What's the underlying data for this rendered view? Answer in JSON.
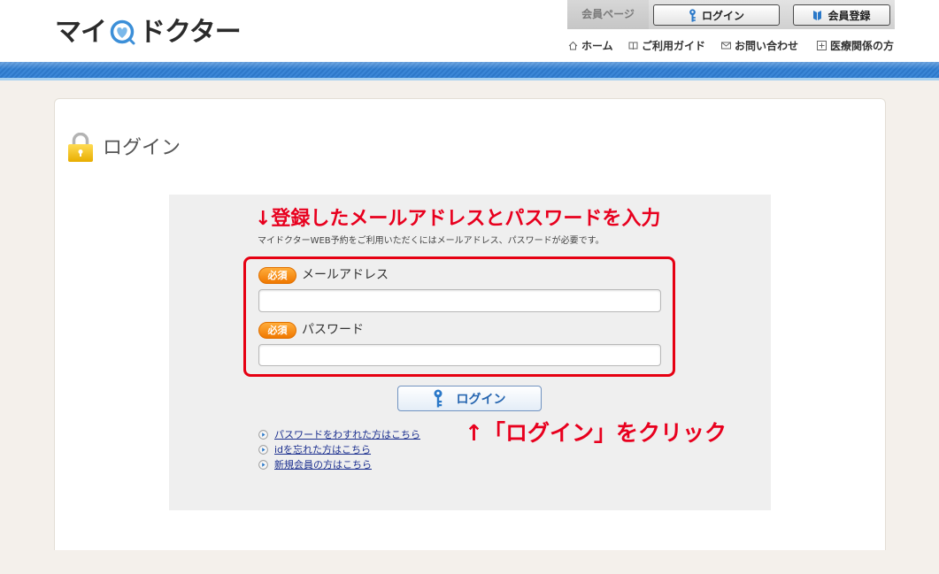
{
  "header": {
    "logo": {
      "left": "マイ",
      "right": "ドクター",
      "icon": "heart-stethoscope-icon"
    },
    "member_page_label": "会員ページ",
    "login_button": {
      "label": "ログイン",
      "icon": "key-icon"
    },
    "register_button": {
      "label": "会員登録",
      "icon": "book-icon"
    },
    "nav": [
      {
        "label": "ホーム",
        "icon": "home-icon"
      },
      {
        "label": "ご利用ガイド",
        "icon": "open-book-icon"
      },
      {
        "label": "お問い合わせ",
        "icon": "envelope-icon"
      },
      {
        "label": "医療関係の方",
        "icon": "plus-square-icon"
      }
    ]
  },
  "main": {
    "title": "ログイン",
    "title_icon": "padlock-icon",
    "annotation_top": "↓登録したメールアドレスとパスワードを入力",
    "description": "マイドクターWEB予約をご利用いただくにはメールアドレス、パスワードが必要です。",
    "form": {
      "email": {
        "badge": "必須",
        "label": "メールアドレス",
        "value": ""
      },
      "password": {
        "badge": "必須",
        "label": "パスワード",
        "value": ""
      },
      "submit": {
        "label": "ログイン",
        "icon": "key-icon"
      }
    },
    "annotation_bottom": "↑「ログイン」をクリック",
    "links": [
      {
        "label": "パスワードをわすれた方はこちら",
        "icon": "circle-arrow-icon"
      },
      {
        "label": "idを忘れた方はこちら",
        "icon": "circle-arrow-icon"
      },
      {
        "label": "新規会員の方はこちら",
        "icon": "circle-arrow-icon"
      }
    ]
  },
  "colors": {
    "annotation_red": "#e8001e",
    "brand_blue": "#2e78c9",
    "badge_orange": "#f07800",
    "page_background": "#f4f0eb",
    "form_background": "#efefef"
  }
}
